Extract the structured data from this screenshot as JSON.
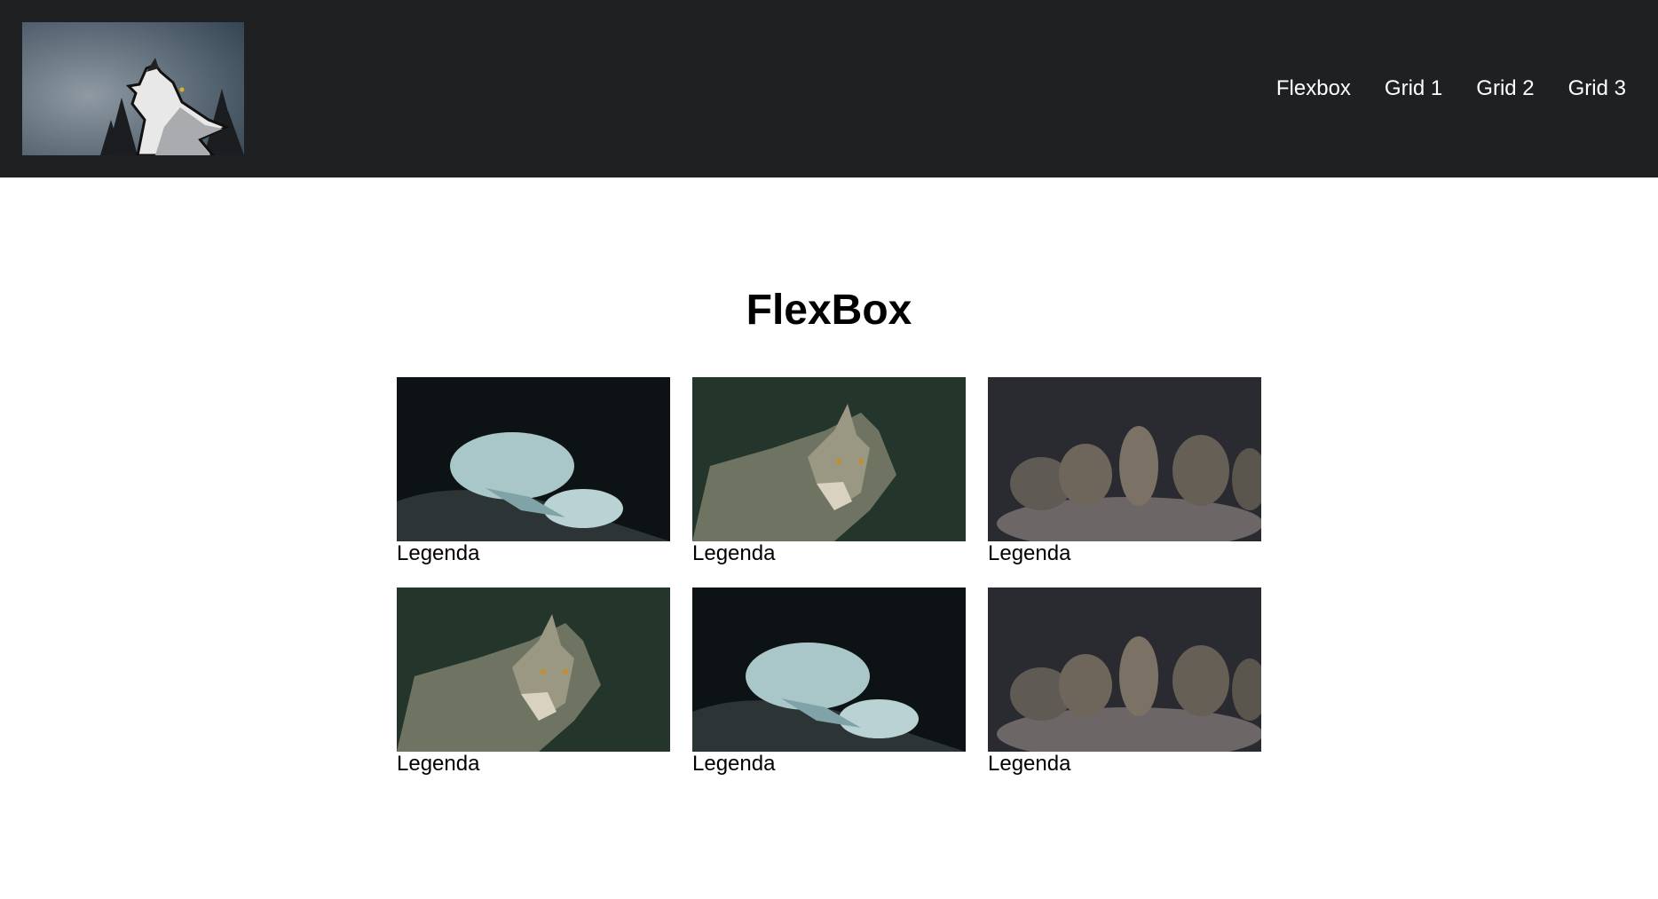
{
  "header": {
    "logo_name": "howling-wolf-logo",
    "nav": [
      {
        "label": "Flexbox"
      },
      {
        "label": "Grid 1"
      },
      {
        "label": "Grid 2"
      },
      {
        "label": "Grid 3"
      }
    ]
  },
  "main": {
    "title": "FlexBox",
    "cards": [
      {
        "image": "white-wolf-lying",
        "caption": "Legenda"
      },
      {
        "image": "grey-wolf-portrait",
        "caption": "Legenda"
      },
      {
        "image": "wolf-pack-rocks",
        "caption": "Legenda"
      },
      {
        "image": "grey-wolf-portrait",
        "caption": "Legenda"
      },
      {
        "image": "white-wolf-lying",
        "caption": "Legenda"
      },
      {
        "image": "wolf-pack-rocks",
        "caption": "Legenda"
      }
    ]
  },
  "colors": {
    "header_bg": "#1f2022",
    "nav_text": "#ffffff",
    "page_bg": "#ffffff"
  }
}
